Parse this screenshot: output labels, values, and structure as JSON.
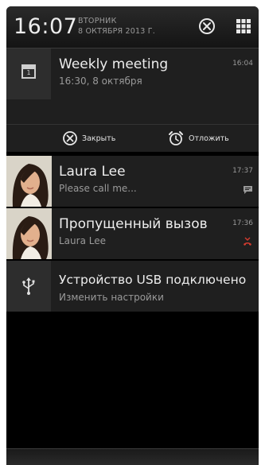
{
  "status_bar": {
    "time": "16:07",
    "day": "ВТОРНИК",
    "date": "8 ОКТЯБРЯ 2013 Г.",
    "clear_icon": "close-circle-icon",
    "settings_icon": "grid-icon"
  },
  "notifications": [
    {
      "icon": "calendar-icon",
      "icon_text": "1",
      "title": "Weekly meeting",
      "subtitle": "16:30, 8 октября",
      "time": "16:04",
      "actions": [
        {
          "icon": "close-circle-icon",
          "label": "Закрыть"
        },
        {
          "icon": "alarm-clock-icon",
          "label": "Отложить"
        }
      ]
    },
    {
      "icon": "contact-photo",
      "title": "Laura Lee",
      "subtitle": "Please call me...",
      "time": "17:37",
      "badge_icon": "message-icon"
    },
    {
      "icon": "contact-photo",
      "title": "Пропущенный вызов",
      "subtitle": "Laura Lee",
      "time": "17:36",
      "badge_icon": "missed-call-icon",
      "badge_color": "#d23b2f"
    },
    {
      "icon": "usb-icon",
      "title": "Устройство USB подключено",
      "subtitle": "Изменить настройки"
    }
  ]
}
